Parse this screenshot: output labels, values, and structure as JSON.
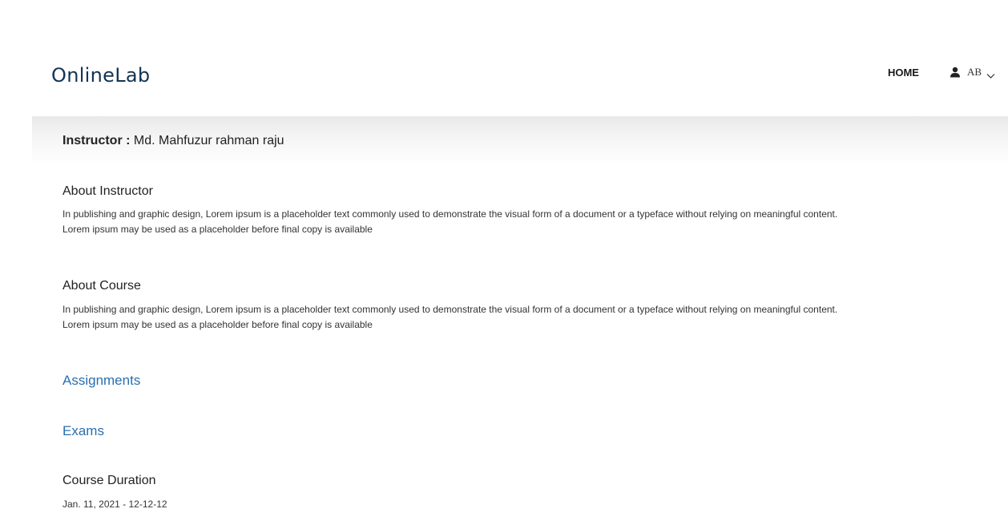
{
  "navbar": {
    "brand": "OnlineLab",
    "home_label": "HOME",
    "user_initials": "AB"
  },
  "instructor": {
    "label": "Instructor :",
    "name": "Md. Mahfuzur rahman raju"
  },
  "about_instructor": {
    "title": "About Instructor",
    "text": "In publishing and graphic design, Lorem ipsum is a placeholder text commonly used to demonstrate the visual form of a document or a typeface without relying on meaningful content. Lorem ipsum may be used as a placeholder before final copy is available"
  },
  "about_course": {
    "title": "About Course",
    "text": "In publishing and graphic design, Lorem ipsum is a placeholder text commonly used to demonstrate the visual form of a document or a typeface without relying on meaningful content. Lorem ipsum may be used as a placeholder before final copy is available"
  },
  "links": {
    "assignments": "Assignments",
    "exams": "Exams"
  },
  "course_duration": {
    "title": "Course Duration",
    "value": "Jan. 11, 2021 - 12-12-12"
  },
  "colors": {
    "brand": "#123454",
    "link": "#2a6fb0"
  },
  "icons": {
    "user": "user-icon",
    "dropdown": "chevron-down-icon"
  }
}
